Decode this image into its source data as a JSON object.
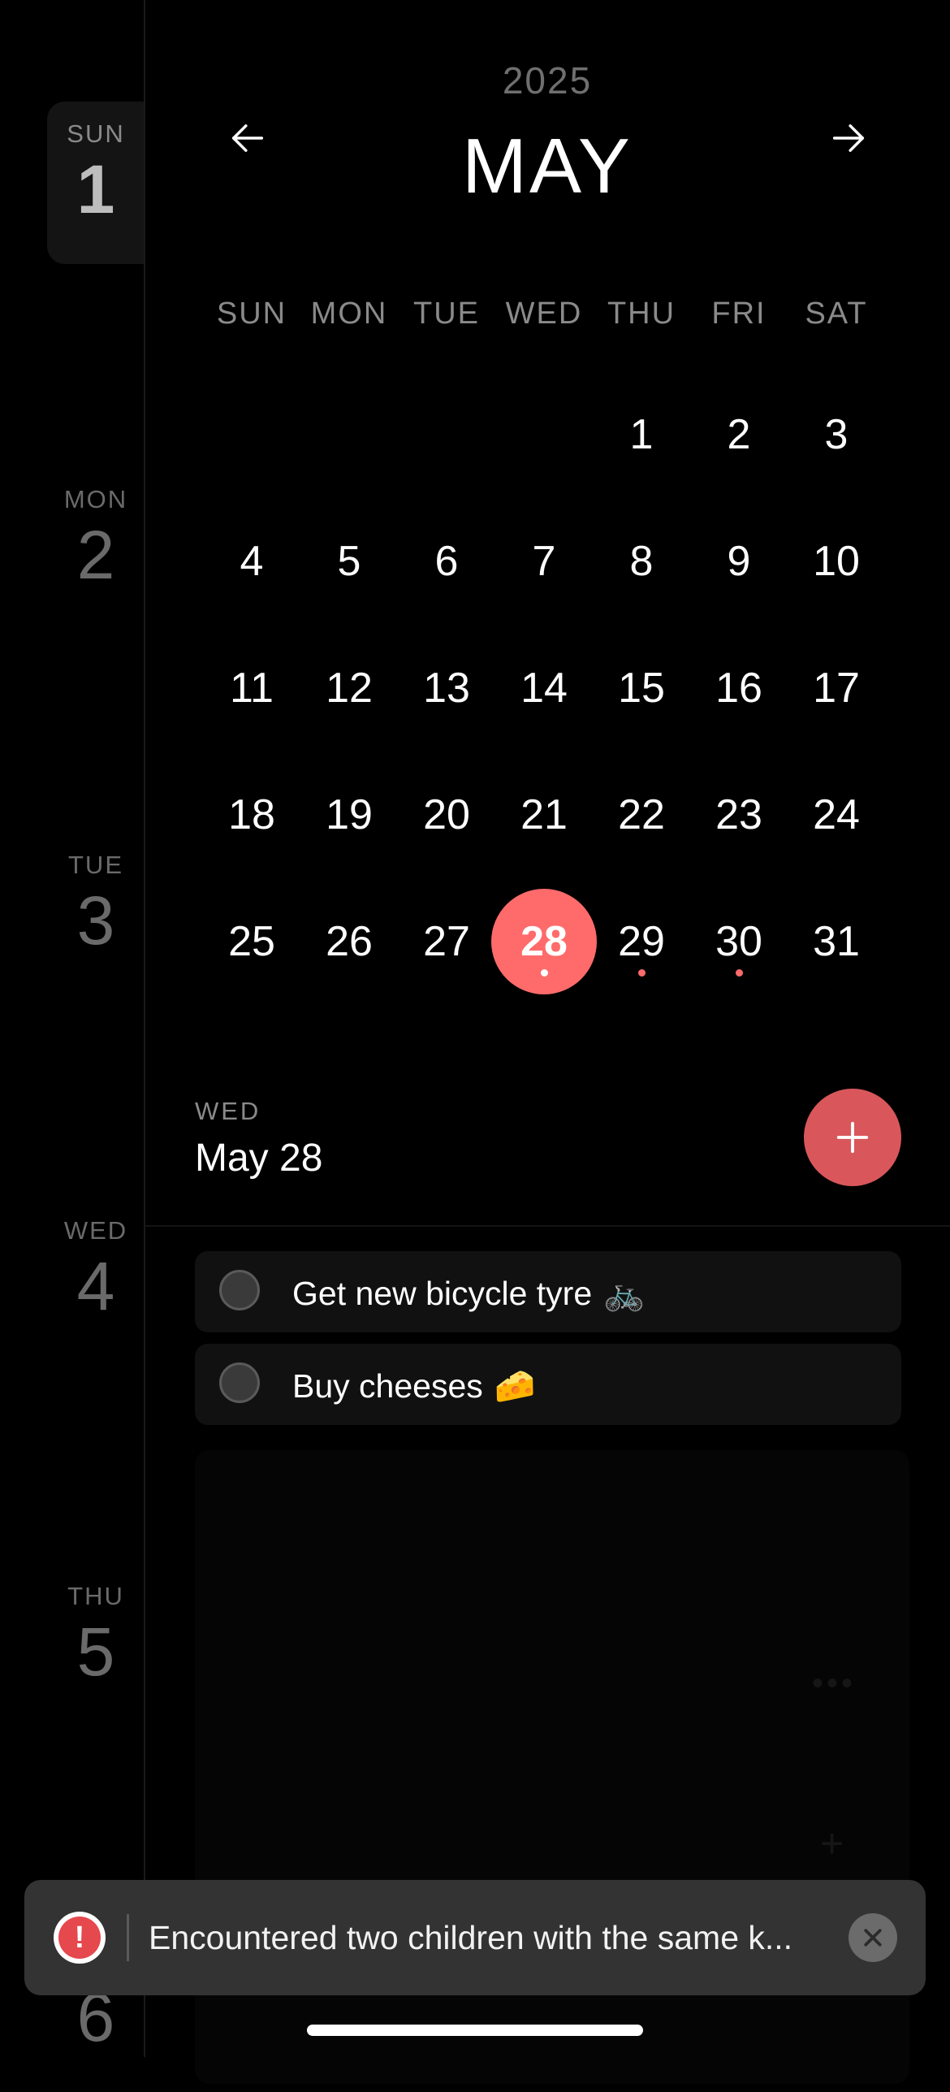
{
  "day_strip": [
    {
      "dow": "SUN",
      "num": "1",
      "active": true
    },
    {
      "dow": "MON",
      "num": "2",
      "active": false
    },
    {
      "dow": "TUE",
      "num": "3",
      "active": false
    },
    {
      "dow": "WED",
      "num": "4",
      "active": false
    },
    {
      "dow": "THU",
      "num": "5",
      "active": false
    },
    {
      "dow": "",
      "num": "6",
      "active": false
    }
  ],
  "header": {
    "year": "2025",
    "month": "MAY"
  },
  "calendar": {
    "weekdays": [
      "SUN",
      "MON",
      "TUE",
      "WED",
      "THU",
      "FRI",
      "SAT"
    ],
    "first_weekday_index": 4,
    "days_in_month": 31,
    "selected_day": 28,
    "days_with_events": [
      28,
      29,
      30
    ]
  },
  "selected": {
    "dow": "WED",
    "date": "May 28"
  },
  "tasks": [
    {
      "text": "Get new bicycle tyre",
      "emoji": "🚲",
      "done": false
    },
    {
      "text": "Buy cheeses",
      "emoji": "🧀",
      "done": false
    }
  ],
  "toast": {
    "icon": "!",
    "message": "Encountered two children with the same k..."
  },
  "colors": {
    "accent": "#ff6b6b",
    "fab": "#d9575b",
    "error": "#e5484d",
    "background": "#000000"
  }
}
